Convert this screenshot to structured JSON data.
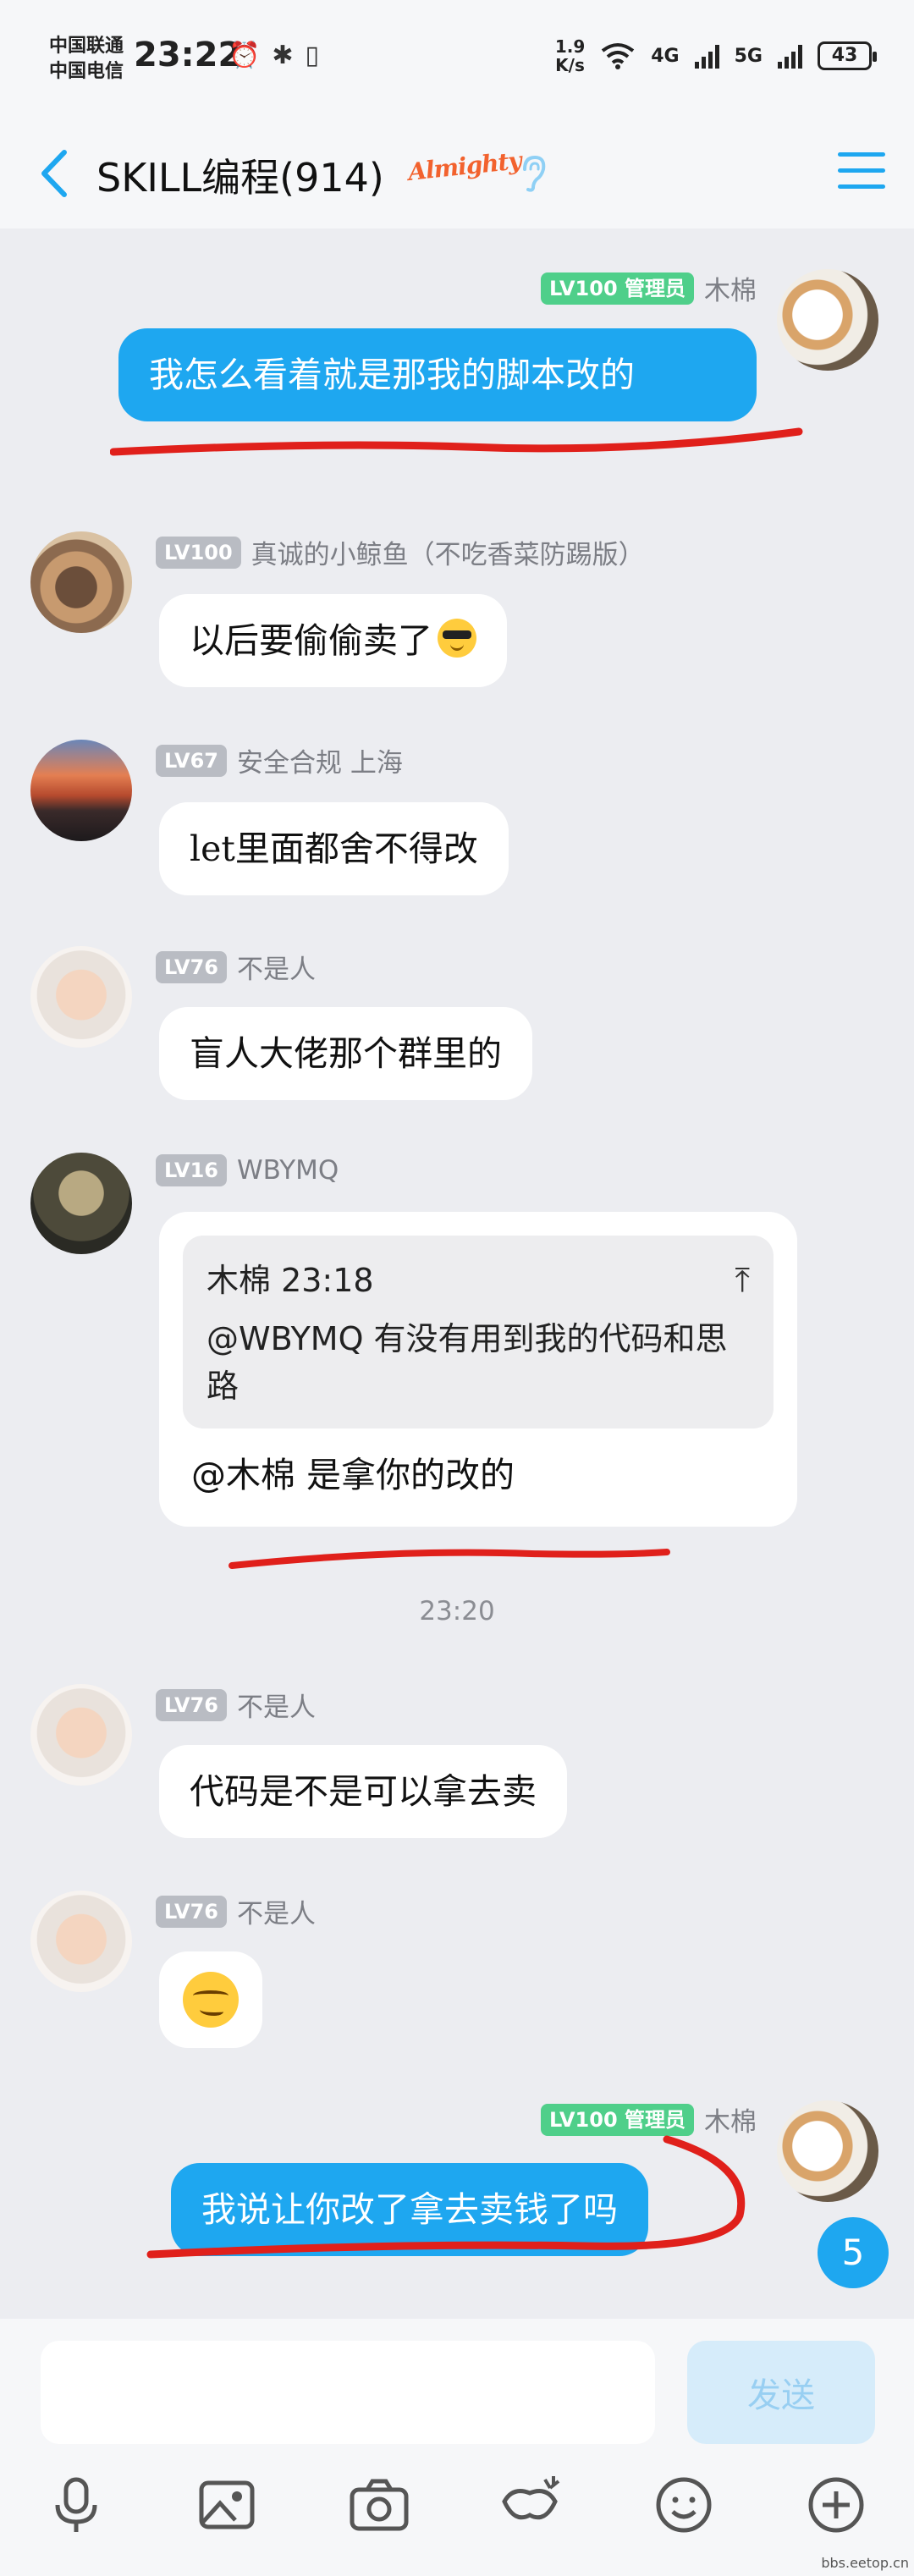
{
  "status_bar": {
    "carrier1": "中国联通",
    "carrier2": "中国电信",
    "time": "23:22",
    "speed_value": "1.9",
    "speed_unit": "K/s",
    "net_4g": "4G",
    "net_5g": "5G",
    "battery": "43"
  },
  "nav": {
    "title": "SKILL编程(914)",
    "badge": "Almighty"
  },
  "messages": [
    {
      "level": "LV100 管理员",
      "name": "木棉",
      "text": "我怎么看着就是那我的脚本改的"
    },
    {
      "level": "LV100",
      "name": "真诚的小鲸鱼（不吃香菜防踢版）",
      "text": "以后要偷偷卖了"
    },
    {
      "level": "LV67",
      "name": "安全合规 上海",
      "text": "let里面都舍不得改"
    },
    {
      "level": "LV76",
      "name": "不是人",
      "text": "盲人大佬那个群里的"
    },
    {
      "level": "LV16",
      "name": "WBYMQ",
      "quote_head": "木棉 23:18",
      "quote_text": "@WBYMQ 有没有用到我的代码和思路",
      "text": "@木棉 是拿你的改的"
    },
    {
      "level": "LV76",
      "name": "不是人",
      "text": "代码是不是可以拿去卖"
    },
    {
      "level": "LV76",
      "name": "不是人"
    },
    {
      "level": "LV100 管理员",
      "name": "木棉",
      "text": "我说让你改了拿去卖钱了吗"
    }
  ],
  "time_separator": "23:20",
  "unread_count": "5",
  "input": {
    "placeholder": "",
    "send_label": "发送"
  },
  "toolbar": [
    "mic-icon",
    "image-icon",
    "camera-icon",
    "red-packet-icon",
    "emoji-icon",
    "plus-icon"
  ],
  "watermark": "bbs.eetop.cn",
  "colors": {
    "accent": "#1ea7f0",
    "admin_badge": "#4fcf8a",
    "underline": "#e0201b"
  }
}
